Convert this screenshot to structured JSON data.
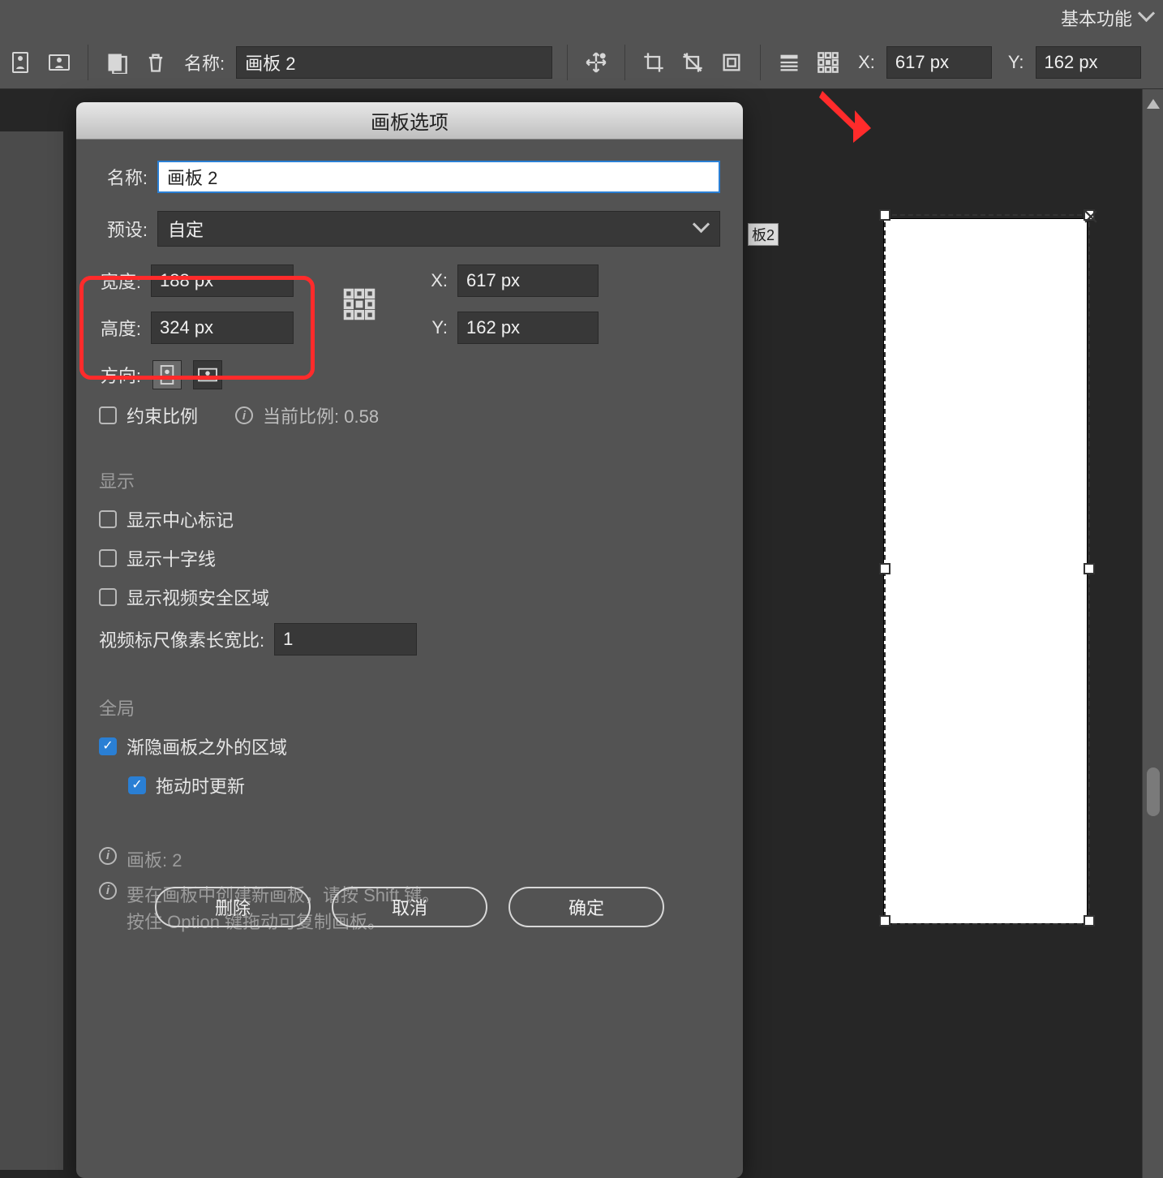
{
  "topbar": {
    "workspace_label": "基本功能"
  },
  "controlbar": {
    "name_label": "名称:",
    "name_value": "画板 2",
    "x_label": "X:",
    "x_value": "617 px",
    "y_label": "Y:",
    "y_value": "162 px"
  },
  "artboard_tag": "板2",
  "dialog": {
    "title": "画板选项",
    "name_label": "名称:",
    "name_value": "画板 2",
    "preset_label": "预设:",
    "preset_value": "自定",
    "width_label": "宽度:",
    "width_value": "188 px",
    "height_label": "高度:",
    "height_value": "324 px",
    "x_label": "X:",
    "x_value": "617 px",
    "y_label": "Y:",
    "y_value": "162 px",
    "orient_label": "方向:",
    "constrain_label": "约束比例",
    "current_ratio_label": "当前比例: 0.58",
    "display_head": "显示",
    "show_center": "显示中心标记",
    "show_cross": "显示十字线",
    "show_safe": "显示视频安全区域",
    "video_aspect_label": "视频标尺像素长宽比:",
    "video_aspect_value": "1",
    "global_head": "全局",
    "fade_label": "渐隐画板之外的区域",
    "drag_update_label": "拖动时更新",
    "info_artboards": "画板: 2",
    "info_hint1": "要在画板中创建新画板，请按 Shift 键。",
    "info_hint2": "按住 Option 键拖动可复制画板。",
    "btn_delete": "删除",
    "btn_cancel": "取消",
    "btn_ok": "确定"
  }
}
